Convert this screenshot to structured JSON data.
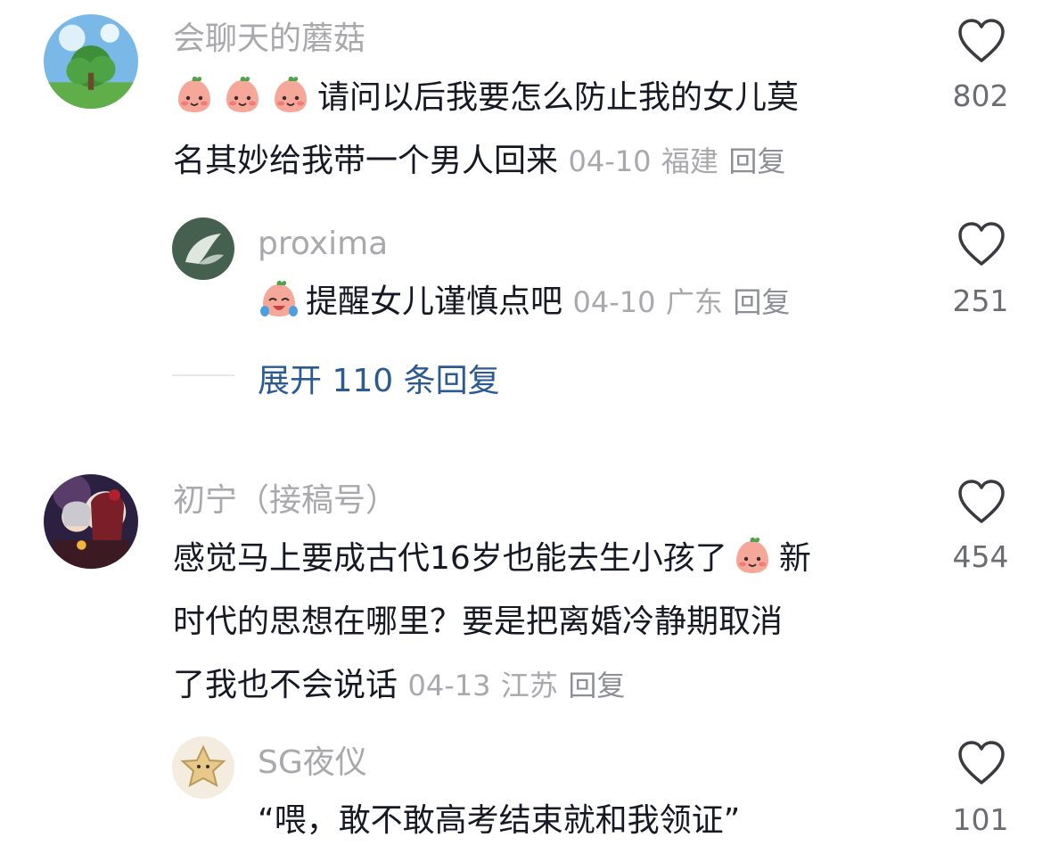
{
  "comments": [
    {
      "username": "会聊天的蘑菇",
      "lines": [
        "请问以后我要怎么防止我的女儿莫",
        "名其妙给我带一个男人回来"
      ],
      "emojis": [
        "peach-smile-emoji",
        "peach-smile-emoji",
        "peach-smile-emoji"
      ],
      "date": "04-10",
      "location": "福建",
      "reply_label": "回复",
      "likes": "802",
      "replies": [
        {
          "username": "proxima",
          "text": "提醒女儿谨慎点吧",
          "emoji": "peach-crying-laugh-emoji",
          "date": "04-10",
          "location": "广东",
          "reply_label": "回复",
          "likes": "251"
        }
      ],
      "expand_label": "展开 110 条回复"
    },
    {
      "username": "初宁（接稿号）",
      "lines": [
        "感觉马上要成古代16岁也能去生小孩了",
        "时代的思想在哪里？要是把离婚冷静期取消",
        "了我也不会说话"
      ],
      "line1_suffix": "新",
      "emoji": "peach-smile-emoji",
      "date": "04-13",
      "location": "江苏",
      "reply_label": "回复",
      "likes": "454",
      "replies": [
        {
          "username": "SG夜仪",
          "text": "“喂，敢不敢高考结束就和我领证”",
          "likes": "101"
        }
      ]
    }
  ],
  "colors": {
    "username": "#a9a9ad",
    "body_text": "#161823",
    "link": "#2b5a93",
    "like_count": "#6b6d73"
  },
  "icons": [
    "heart-outline-icon"
  ]
}
